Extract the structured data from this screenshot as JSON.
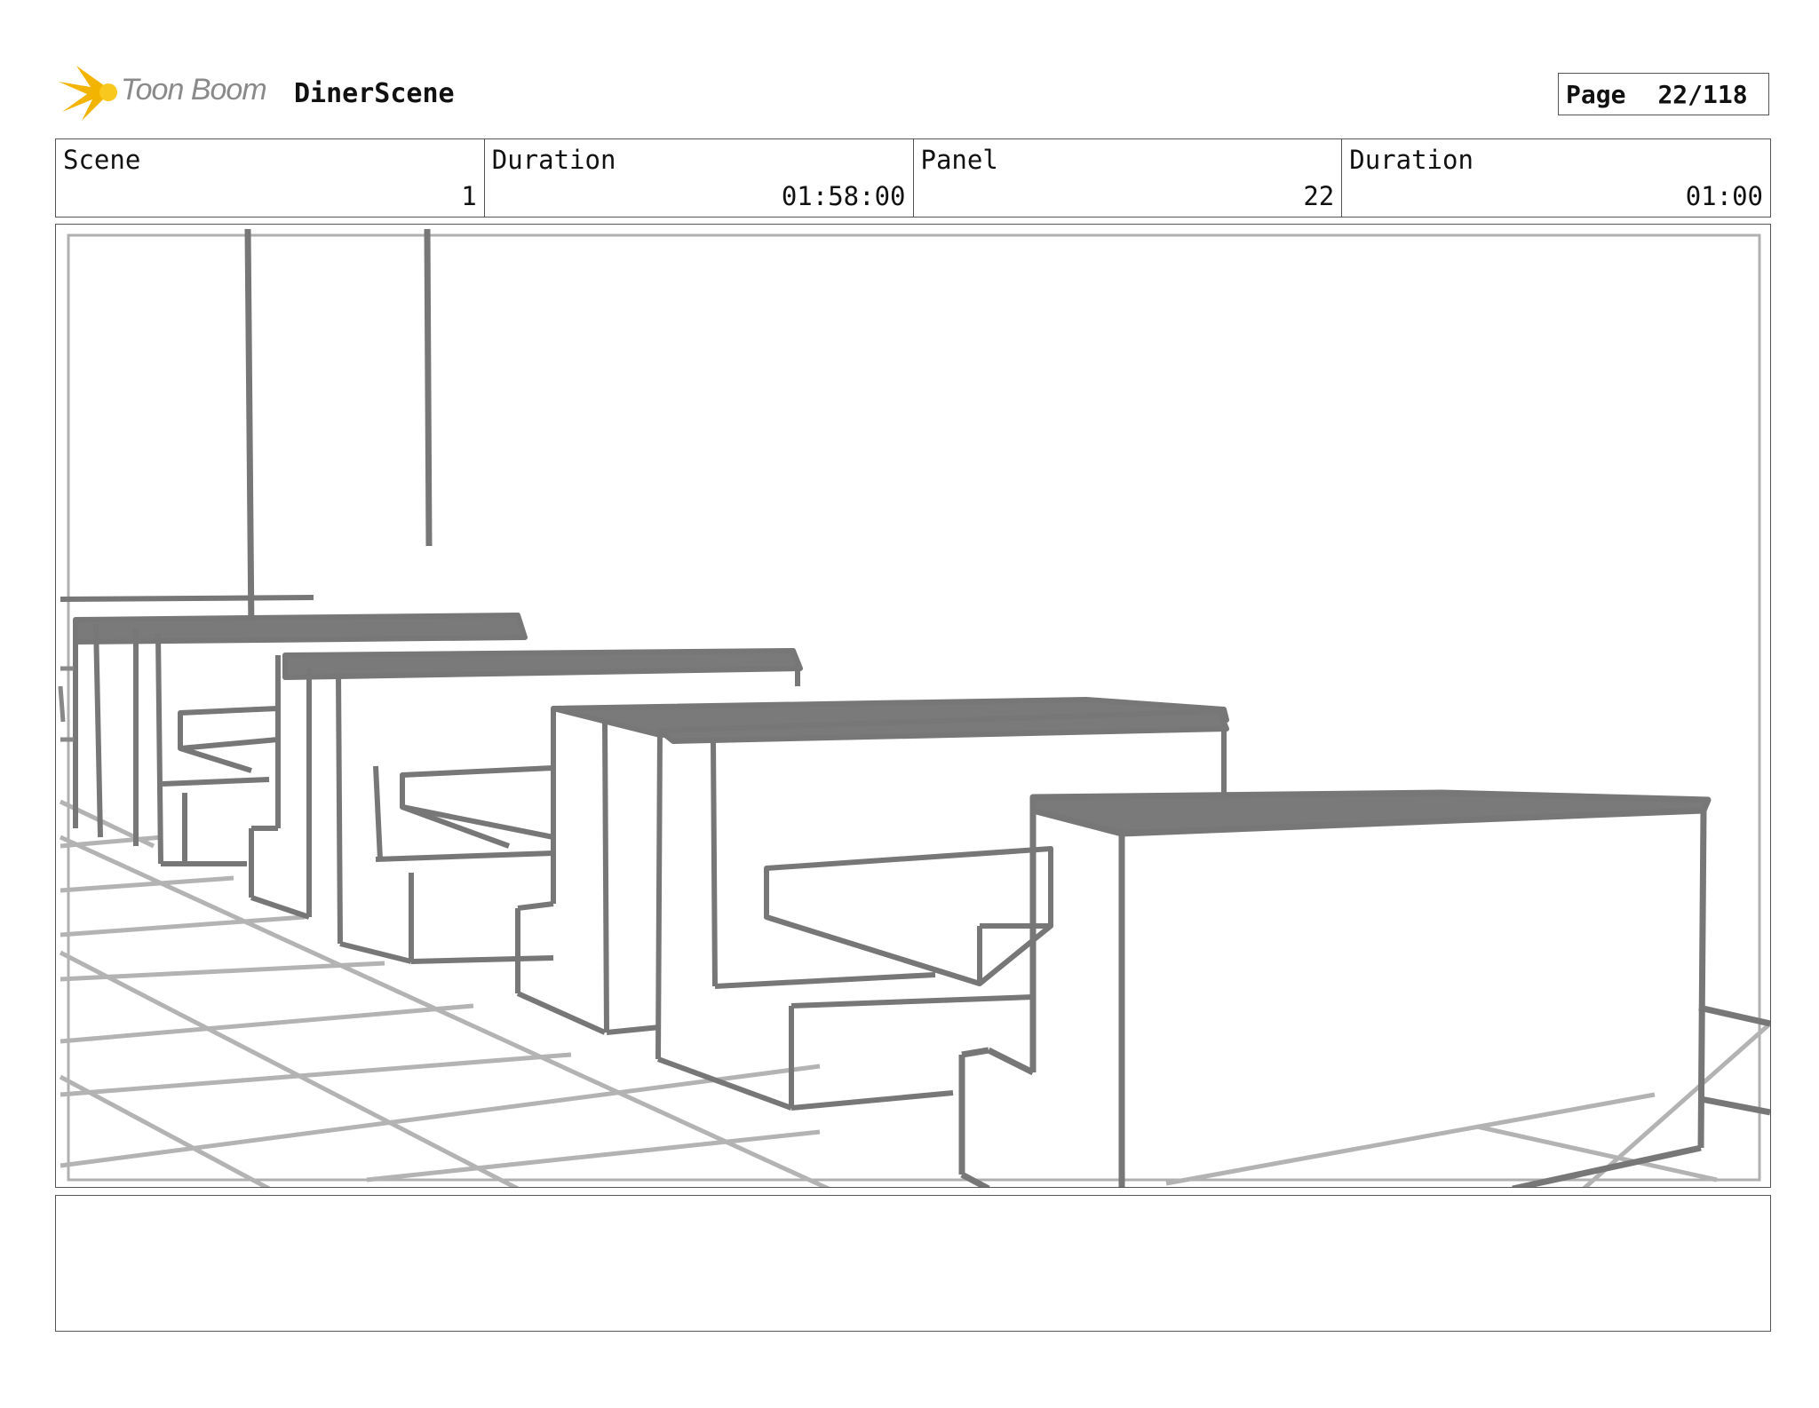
{
  "header": {
    "logo_text": "Toon Boom",
    "project_title": "DinerScene",
    "page_label": "Page",
    "page_number": "22/118"
  },
  "info": [
    {
      "label": "Scene",
      "value": "1"
    },
    {
      "label": "Duration",
      "value": "01:58:00"
    },
    {
      "label": "Panel",
      "value": "22"
    },
    {
      "label": "Duration",
      "value": "01:00"
    }
  ],
  "panel": {
    "description": "",
    "line_color": "#777777",
    "floor_color": "#b3b3b3",
    "top_fill": "#7a7a7a"
  },
  "notes": {
    "text": ""
  }
}
